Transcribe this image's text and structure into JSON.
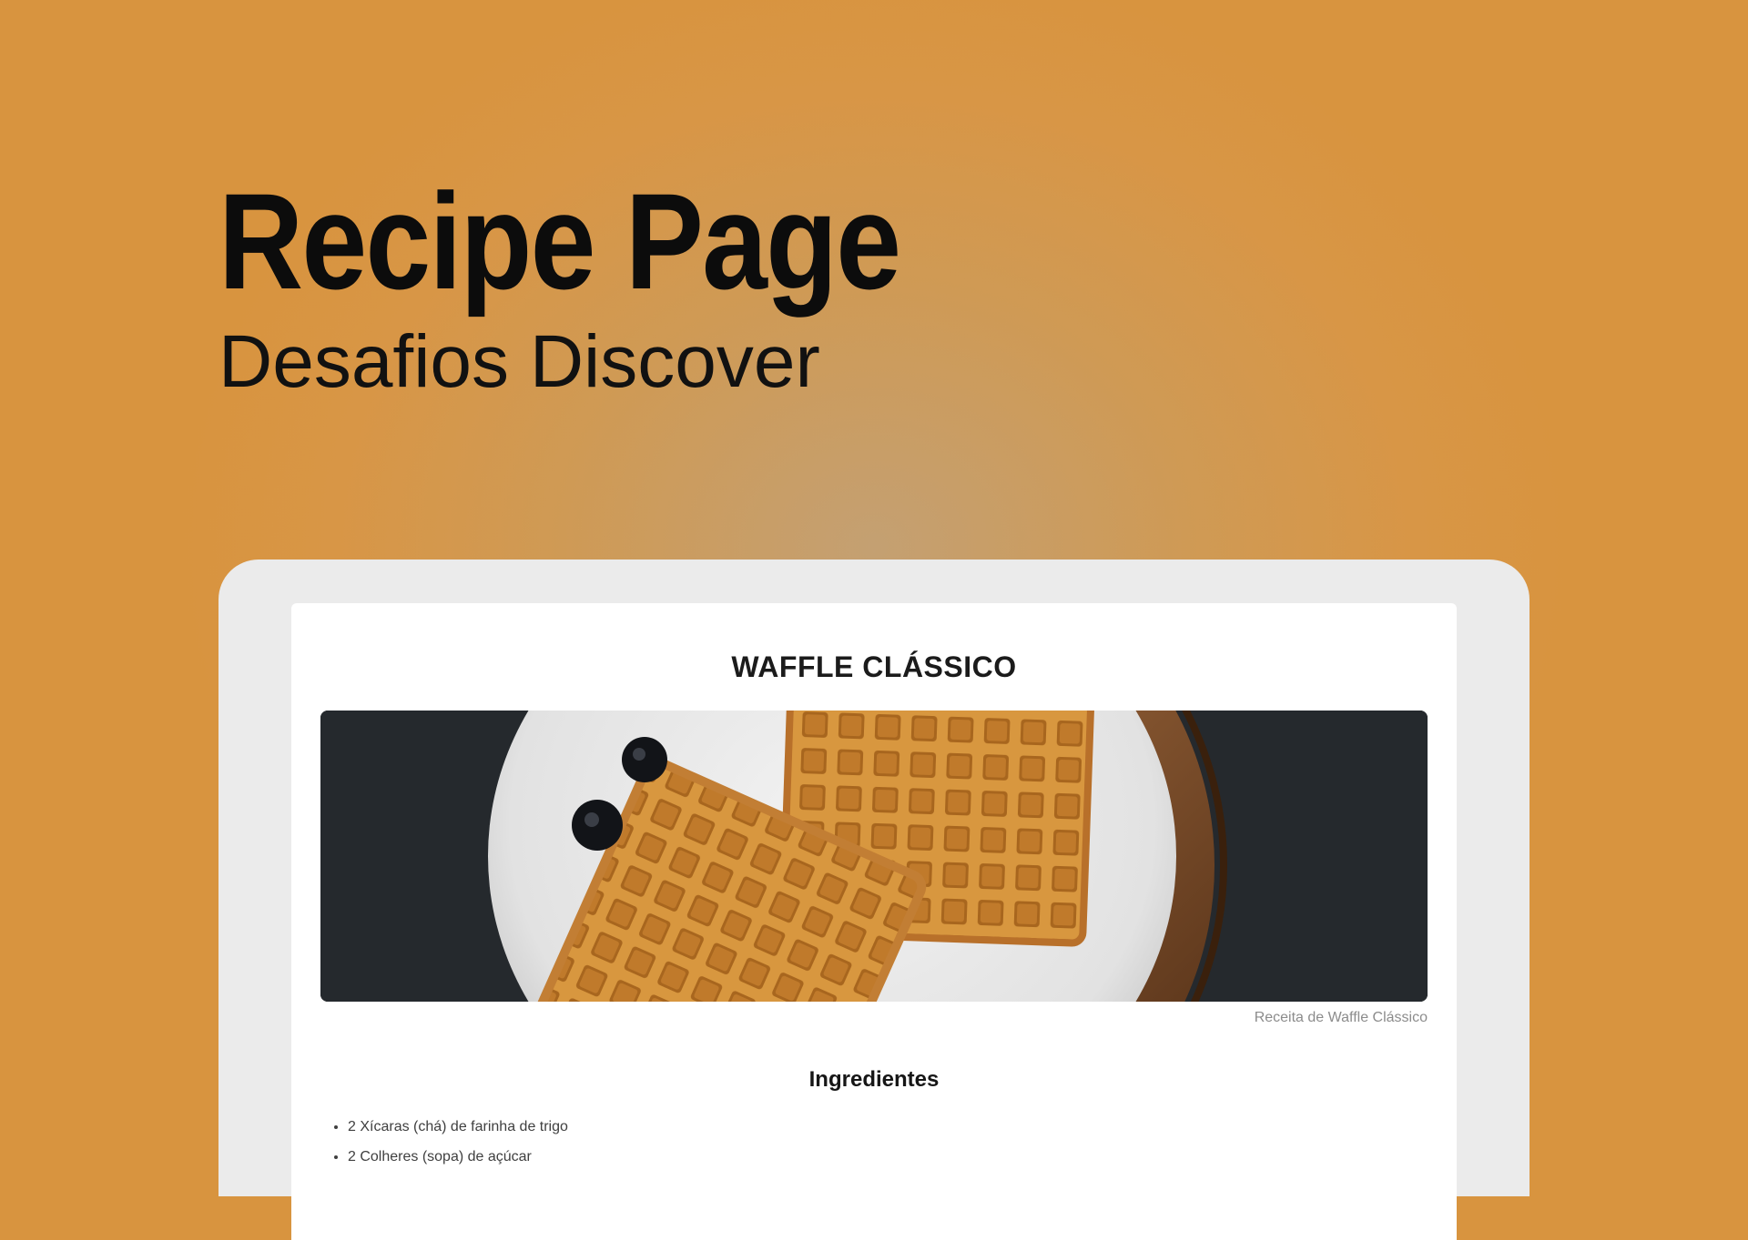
{
  "hero": {
    "title": "Recipe Page",
    "subtitle": "Desafios Discover"
  },
  "recipe": {
    "title": "WAFFLE CLÁSSICO",
    "image_caption": "Receita de Waffle Clássico",
    "ingredients_heading": "Ingredientes",
    "ingredients": [
      "2 Xícaras (chá) de farinha de trigo",
      "2 Colheres (sopa) de açúcar"
    ]
  },
  "colors": {
    "background": "#d8943f",
    "frame": "#ebebeb",
    "card": "#ffffff",
    "heading_text": "#0c0c0c",
    "caption_text": "#8c8c8c"
  }
}
